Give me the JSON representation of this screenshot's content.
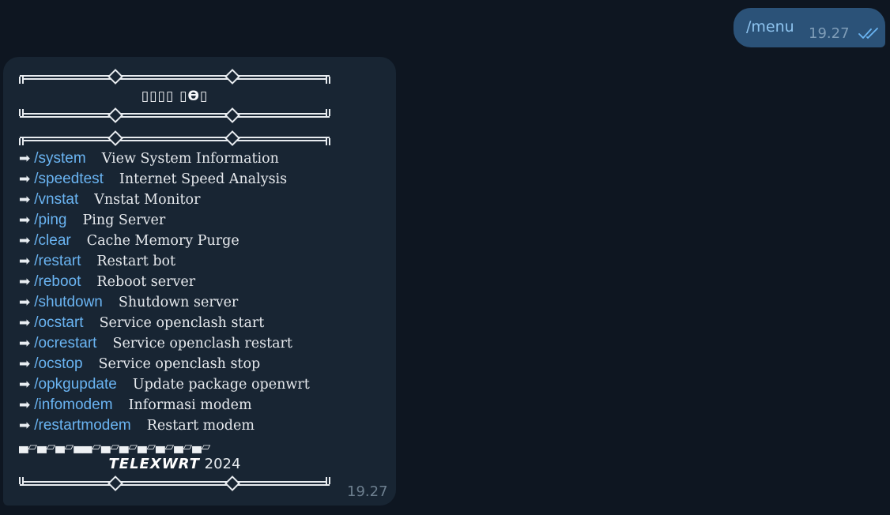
{
  "outgoing": {
    "text": "/menu",
    "time": "19.27"
  },
  "incoming": {
    "title": "▯▯▯▯ ▯ϴ▯",
    "commands": [
      {
        "cmd": "/system",
        "desc": "View System Information"
      },
      {
        "cmd": "/speedtest",
        "desc": "Internet Speed Analysis"
      },
      {
        "cmd": "/vnstat",
        "desc": "Vnstat Monitor"
      },
      {
        "cmd": "/ping",
        "desc": "Ping Server"
      },
      {
        "cmd": "/clear",
        "desc": "Cache Memory Purge"
      },
      {
        "cmd": "/restart",
        "desc": "Restart bot"
      },
      {
        "cmd": "/reboot",
        "desc": "Reboot server"
      },
      {
        "cmd": "/shutdown",
        "desc": "Shutdown server"
      },
      {
        "cmd": "/ocstart",
        "desc": "Service openclash start"
      },
      {
        "cmd": "/ocrestart",
        "desc": "Service openclash restart"
      },
      {
        "cmd": "/ocstop",
        "desc": "Service openclash stop"
      },
      {
        "cmd": "/opkgupdate",
        "desc": "Update package openwrt"
      },
      {
        "cmd": "/infomodem",
        "desc": "Informasi modem"
      },
      {
        "cmd": "/restartmodem",
        "desc": "Restart modem"
      }
    ],
    "arrow": "➡",
    "block_strip": "▄▱▄▱▄▱▄▄▱▄▱▄▱▄▱▄▱▄▱▄▱",
    "brand": "TELEXWRT",
    "year": "2024",
    "time": "19.27"
  },
  "colors": {
    "background": "#0e1621",
    "outgoing_bubble": "#2b5278",
    "incoming_bubble": "#182533",
    "link": "#6ab4f2"
  }
}
